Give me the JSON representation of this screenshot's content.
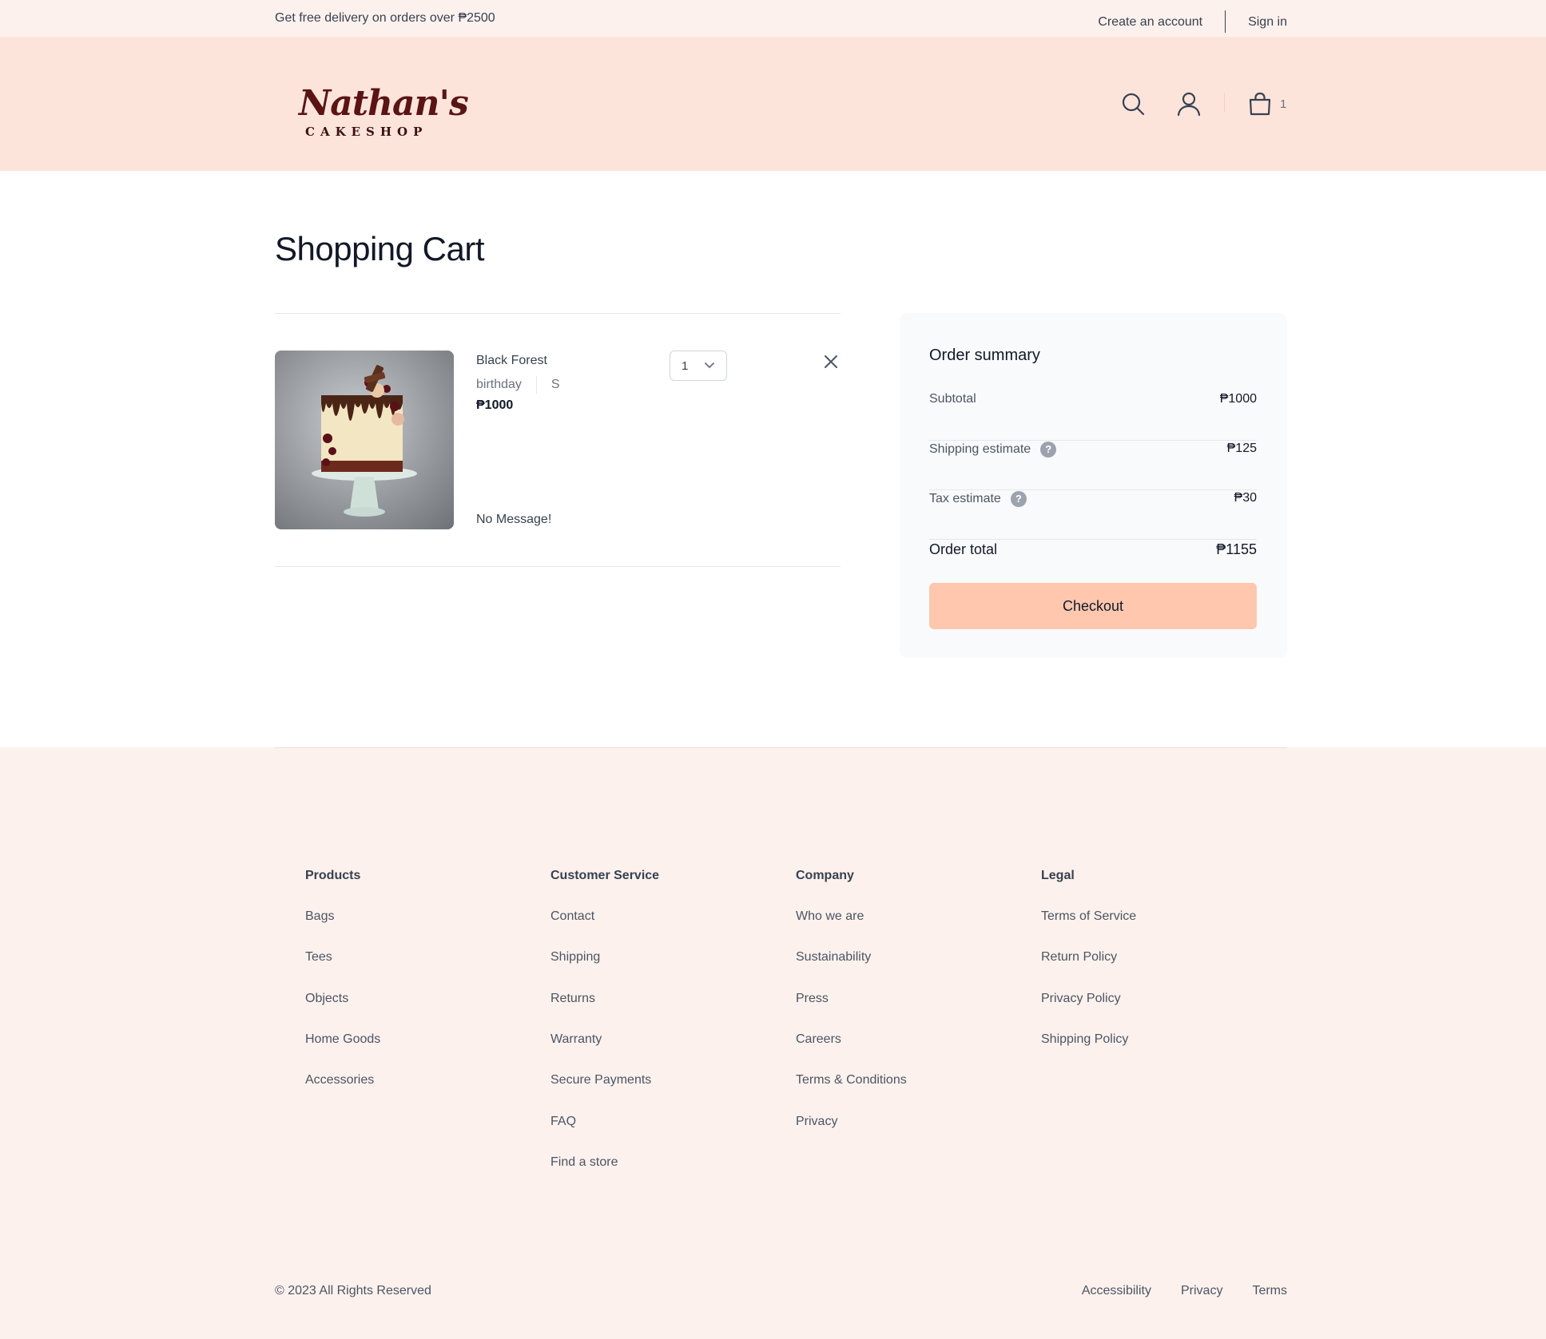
{
  "topbar": {
    "promo": "Get free delivery on orders over ₱2500",
    "create_account": "Create an account",
    "sign_in": "Sign in"
  },
  "header": {
    "logo_script": "Nathan's",
    "logo_sub": "CAKESHOP",
    "cart_count": "1",
    "icons": [
      "search-icon",
      "user-icon",
      "shopping-bag-icon"
    ]
  },
  "main": {
    "title": "Shopping Cart",
    "items": [
      {
        "name": "Black Forest",
        "occasion": "birthday",
        "size": "S",
        "price": "₱1000",
        "message": "No Message!",
        "quantity": "1"
      }
    ]
  },
  "summary": {
    "title": "Order summary",
    "subtotal_label": "Subtotal",
    "subtotal_value": "₱1000",
    "shipping_label": "Shipping estimate",
    "shipping_value": "₱125",
    "tax_label": "Tax estimate",
    "tax_value": "₱30",
    "total_label": "Order total",
    "total_value": "₱1155",
    "checkout_label": "Checkout",
    "help_glyph": "?"
  },
  "footer": {
    "columns": [
      {
        "title": "Products",
        "links": [
          "Bags",
          "Tees",
          "Objects",
          "Home Goods",
          "Accessories"
        ]
      },
      {
        "title": "Customer Service",
        "links": [
          "Contact",
          "Shipping",
          "Returns",
          "Warranty",
          "Secure Payments",
          "FAQ",
          "Find a store"
        ]
      },
      {
        "title": "Company",
        "links": [
          "Who we are",
          "Sustainability",
          "Press",
          "Careers",
          "Terms & Conditions",
          "Privacy"
        ]
      },
      {
        "title": "Legal",
        "links": [
          "Terms of Service",
          "Return Policy",
          "Privacy Policy",
          "Shipping Policy"
        ]
      }
    ],
    "copyright": "© 2023 All Rights Reserved",
    "bottom_links": [
      "Accessibility",
      "Privacy",
      "Terms"
    ]
  },
  "colors": {
    "topbar_bg": "#fdf1ed",
    "header_bg": "#fde4db",
    "checkout_bg": "#fec7ae",
    "logo": "#5a1414"
  }
}
